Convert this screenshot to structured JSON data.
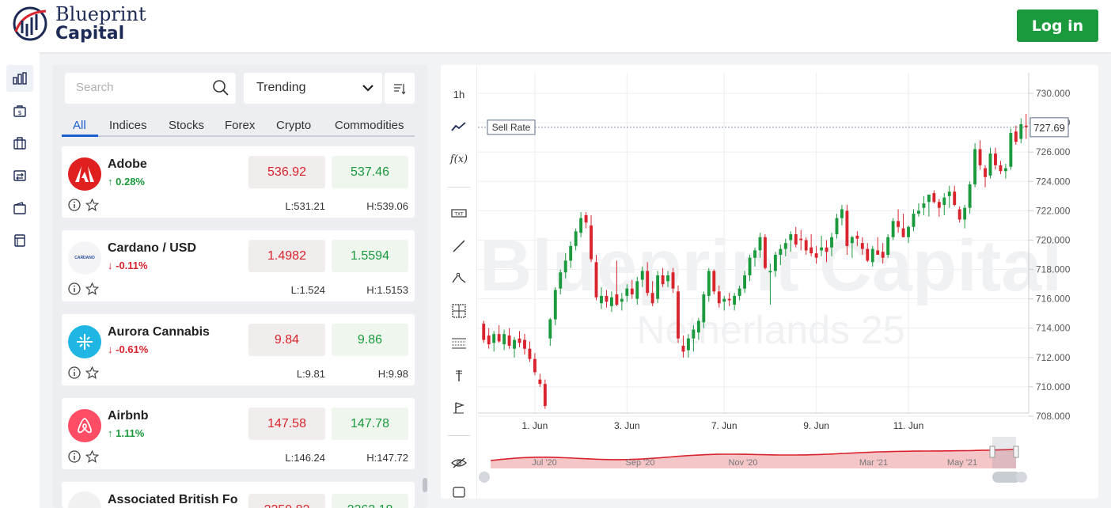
{
  "brand": {
    "line1": "Blueprint",
    "line2": "Capital"
  },
  "header": {
    "login_label": "Log in"
  },
  "rail": {
    "items": [
      "chart-icon",
      "wallet-dollar-icon",
      "briefcase-icon",
      "transfer-icon",
      "wallet-icon",
      "document-icon"
    ]
  },
  "watchlist": {
    "search_placeholder": "Search",
    "filter_selected": "Trending",
    "tabs": [
      "All",
      "Indices",
      "Stocks",
      "Forex",
      "Crypto",
      "Commodities"
    ],
    "active_tab": "All",
    "assets": [
      {
        "name": "Adobe",
        "change": "0.28%",
        "direction": "up",
        "sell": "536.92",
        "buy": "537.46",
        "low": "L:531.21",
        "high": "H:539.06",
        "logo_bg": "#e01f1f"
      },
      {
        "name": "Cardano / USD",
        "change": "-0.11%",
        "direction": "down",
        "sell": "1.4982",
        "buy": "1.5594",
        "low": "L:1.524",
        "high": "H:1.5153",
        "logo_bg": "#f4f4f6",
        "logo_text": "CARDANO"
      },
      {
        "name": "Aurora Cannabis",
        "change": "-0.61%",
        "direction": "down",
        "sell": "9.84",
        "buy": "9.86",
        "low": "L:9.81",
        "high": "H:9.98",
        "logo_bg": "#20b6e4"
      },
      {
        "name": "Airbnb",
        "change": "1.11%",
        "direction": "up",
        "sell": "147.58",
        "buy": "147.78",
        "low": "L:146.24",
        "high": "H:147.72",
        "logo_bg": "#ff4d66"
      },
      {
        "name": "Associated British Fo",
        "change": "",
        "direction": "",
        "sell": "2359.82",
        "buy": "2362.18",
        "low": "",
        "high": "",
        "logo_bg": "#f1f1f1"
      }
    ]
  },
  "chart_toolbar": {
    "interval": "1h",
    "fx_label": "f(x)"
  },
  "colors": {
    "up": "#1a9a3c",
    "down": "#d9232d",
    "accent": "#1d5fd0"
  },
  "chart_data": {
    "type": "candlestick",
    "watermark": [
      "Blueprint Capital",
      "Netherlands 25"
    ],
    "sell_rate_label": "Sell Rate",
    "sell_rate_value": "727.69",
    "y_ticks": [
      "730.000",
      "728.000",
      "726.000",
      "724.000",
      "722.000",
      "720.000",
      "718.000",
      "716.000",
      "714.000",
      "712.000",
      "710.000",
      "708.000"
    ],
    "ylim": [
      708,
      730
    ],
    "x_ticks": [
      {
        "label": "1. Jun",
        "index": 10
      },
      {
        "label": "3. Jun",
        "index": 28
      },
      {
        "label": "7. Jun",
        "index": 47
      },
      {
        "label": "9. Jun",
        "index": 65
      },
      {
        "label": "11. Jun",
        "index": 83
      }
    ],
    "navigator_labels": [
      "Jul '20",
      "Sep '20",
      "Nov '20",
      "Mar '21",
      "May '21"
    ],
    "candles": [
      [
        714.3,
        714.5,
        713.0,
        713.2
      ],
      [
        713.5,
        714.0,
        712.6,
        712.9
      ],
      [
        713.0,
        713.8,
        712.4,
        713.6
      ],
      [
        713.6,
        714.2,
        713.0,
        713.1
      ],
      [
        712.9,
        713.9,
        712.5,
        713.6
      ],
      [
        713.5,
        714.0,
        712.6,
        712.8
      ],
      [
        712.6,
        713.4,
        712.0,
        713.2
      ],
      [
        713.3,
        713.8,
        712.7,
        713.0
      ],
      [
        713.2,
        713.6,
        712.2,
        712.6
      ],
      [
        712.6,
        713.1,
        711.7,
        711.9
      ],
      [
        711.9,
        712.3,
        710.8,
        711.0
      ],
      [
        710.5,
        710.9,
        710.0,
        710.2
      ],
      [
        710.2,
        710.5,
        708.5,
        708.7
      ],
      [
        713.3,
        714.7,
        712.8,
        714.6
      ],
      [
        714.6,
        716.8,
        714.2,
        716.6
      ],
      [
        716.7,
        718.0,
        716.3,
        717.8
      ],
      [
        717.8,
        719.1,
        717.4,
        718.6
      ],
      [
        718.6,
        719.9,
        718.1,
        719.6
      ],
      [
        719.6,
        720.8,
        719.3,
        720.6
      ],
      [
        720.5,
        721.9,
        720.2,
        721.5
      ],
      [
        721.7,
        721.9,
        720.8,
        721.2
      ],
      [
        721.0,
        721.7,
        718.5,
        718.7
      ],
      [
        718.5,
        719.0,
        715.9,
        716.1
      ],
      [
        715.7,
        716.8,
        715.3,
        716.2
      ],
      [
        716.2,
        716.6,
        715.4,
        715.8
      ],
      [
        715.5,
        716.5,
        715.1,
        716.1
      ],
      [
        716.3,
        718.6,
        715.5,
        715.6
      ],
      [
        715.8,
        716.4,
        715.2,
        716.0
      ],
      [
        716.2,
        717.0,
        715.8,
        716.7
      ],
      [
        716.7,
        717.3,
        716.0,
        716.3
      ],
      [
        716.0,
        717.5,
        715.6,
        717.2
      ],
      [
        717.3,
        718.2,
        716.8,
        717.9
      ],
      [
        717.9,
        718.5,
        716.2,
        716.4
      ],
      [
        716.4,
        717.2,
        715.5,
        715.7
      ],
      [
        716.0,
        717.9,
        715.7,
        717.6
      ],
      [
        717.6,
        718.1,
        716.8,
        717.0
      ],
      [
        717.2,
        717.9,
        716.8,
        717.6
      ],
      [
        717.8,
        718.1,
        716.4,
        716.7
      ],
      [
        716.5,
        716.9,
        713.0,
        713.3
      ],
      [
        712.8,
        713.5,
        712.0,
        712.4
      ],
      [
        712.5,
        713.6,
        712.0,
        713.3
      ],
      [
        713.3,
        714.2,
        712.4,
        713.9
      ],
      [
        713.7,
        714.7,
        713.2,
        714.5
      ],
      [
        714.4,
        716.5,
        714.0,
        716.3
      ],
      [
        716.2,
        718.1,
        715.8,
        717.9
      ],
      [
        717.9,
        718.0,
        716.3,
        716.5
      ],
      [
        716.5,
        716.9,
        715.4,
        715.7
      ],
      [
        715.8,
        716.2,
        715.2,
        716.0
      ],
      [
        716.0,
        716.4,
        715.5,
        715.9
      ],
      [
        715.6,
        716.4,
        715.2,
        716.2
      ],
      [
        716.2,
        716.9,
        715.9,
        716.7
      ],
      [
        716.7,
        717.9,
        716.4,
        717.6
      ],
      [
        717.6,
        719.0,
        717.2,
        718.8
      ],
      [
        718.8,
        719.5,
        718.2,
        719.3
      ],
      [
        719.3,
        720.5,
        718.8,
        720.2
      ],
      [
        720.2,
        720.4,
        718.0,
        718.1
      ],
      [
        717.8,
        718.4,
        715.6,
        717.9
      ],
      [
        717.9,
        719.2,
        717.5,
        719.0
      ],
      [
        719.0,
        719.7,
        718.3,
        719.4
      ],
      [
        719.4,
        720.1,
        718.9,
        719.8
      ],
      [
        720.0,
        720.6,
        719.2,
        720.4
      ],
      [
        720.4,
        720.9,
        719.5,
        719.7
      ],
      [
        720.1,
        720.7,
        719.3,
        720.0
      ],
      [
        720.0,
        720.2,
        719.0,
        719.3
      ],
      [
        719.5,
        720.4,
        718.9,
        719.1
      ],
      [
        719.1,
        719.6,
        718.4,
        718.8
      ],
      [
        719.3,
        720.3,
        718.9,
        719.5
      ],
      [
        719.5,
        720.0,
        718.5,
        719.2
      ],
      [
        719.5,
        720.5,
        718.9,
        720.2
      ],
      [
        720.4,
        721.8,
        720.1,
        721.5
      ],
      [
        721.5,
        722.4,
        721.0,
        722.1
      ],
      [
        722.0,
        722.4,
        719.0,
        719.6
      ],
      [
        719.8,
        720.3,
        718.8,
        720.2
      ],
      [
        720.3,
        720.6,
        719.6,
        720.1
      ],
      [
        719.8,
        720.2,
        719.0,
        719.4
      ],
      [
        719.4,
        719.8,
        718.5,
        718.6
      ],
      [
        718.5,
        719.6,
        718.2,
        719.4
      ],
      [
        719.3,
        720.2,
        719.0,
        719.0
      ],
      [
        719.2,
        719.8,
        718.4,
        718.8
      ],
      [
        719.0,
        720.4,
        718.8,
        720.2
      ],
      [
        720.2,
        721.5,
        720.0,
        721.3
      ],
      [
        721.3,
        722.1,
        720.5,
        720.9
      ],
      [
        720.8,
        721.8,
        720.2,
        720.2
      ],
      [
        720.2,
        721.0,
        719.8,
        720.9
      ],
      [
        720.9,
        722.1,
        720.6,
        721.8
      ],
      [
        721.8,
        722.5,
        721.6,
        722.0
      ],
      [
        722.2,
        723.0,
        721.7,
        722.5
      ],
      [
        722.6,
        723.1,
        721.6,
        723.1
      ],
      [
        723.2,
        723.4,
        722.5,
        722.6
      ],
      [
        722.6,
        722.8,
        721.6,
        722.2
      ],
      [
        722.4,
        723.2,
        721.7,
        722.9
      ],
      [
        723.0,
        723.7,
        722.2,
        723.3
      ],
      [
        723.3,
        723.7,
        722.3,
        722.4
      ],
      [
        722.1,
        722.3,
        721.2,
        721.4
      ],
      [
        721.4,
        722.4,
        720.8,
        722.2
      ],
      [
        722.2,
        724.0,
        721.8,
        723.8
      ],
      [
        723.8,
        726.6,
        723.6,
        726.2
      ],
      [
        726.2,
        726.8,
        724.8,
        725.1
      ],
      [
        724.9,
        725.1,
        723.6,
        724.3
      ],
      [
        724.4,
        726.3,
        724.2,
        725.9
      ],
      [
        725.9,
        726.3,
        724.8,
        725.1
      ],
      [
        725.1,
        725.4,
        724.5,
        724.7
      ],
      [
        724.7,
        725.2,
        724.2,
        724.9
      ],
      [
        725.0,
        727.6,
        724.8,
        727.3
      ],
      [
        727.4,
        727.8,
        726.5,
        726.7
      ],
      [
        726.9,
        728.3,
        726.6,
        727.9
      ],
      [
        727.8,
        728.6,
        726.9,
        727.7
      ]
    ]
  }
}
